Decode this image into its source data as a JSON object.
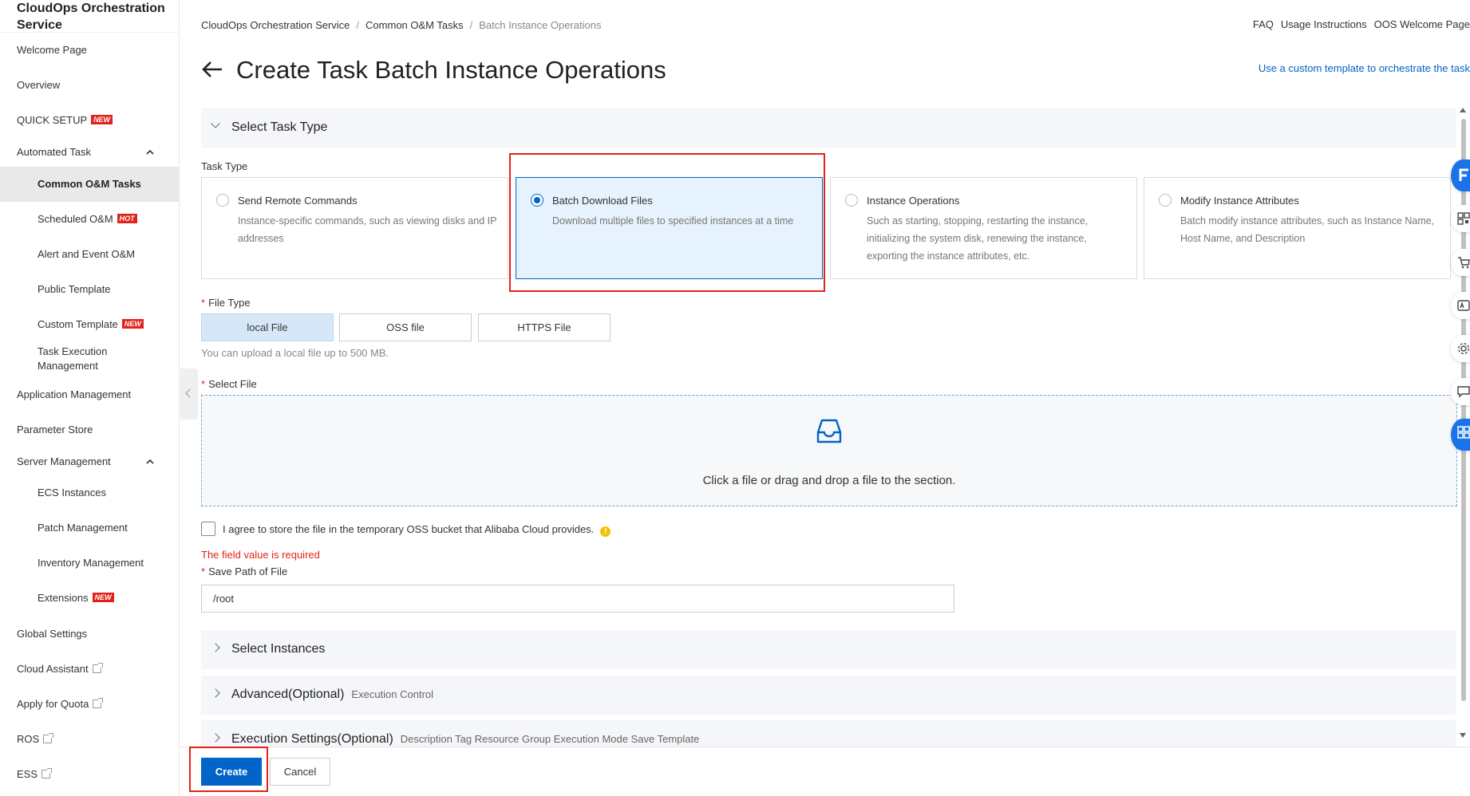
{
  "sidebar": {
    "title": "CloudOps Orchestration Service",
    "items": [
      {
        "label": "Welcome Page"
      },
      {
        "label": "Overview"
      },
      {
        "label": "QUICK SETUP",
        "badge": "NEW"
      },
      {
        "label": "Automated Task"
      },
      {
        "label": "Common O&M Tasks"
      },
      {
        "label": "Scheduled O&M",
        "badge": "HOT"
      },
      {
        "label": "Alert and Event O&M"
      },
      {
        "label": "Public Template"
      },
      {
        "label": "Custom Template",
        "badge": "NEW"
      },
      {
        "label": "Task Execution Management"
      },
      {
        "label": "Application Management"
      },
      {
        "label": "Parameter Store"
      },
      {
        "label": "Server Management"
      },
      {
        "label": "ECS Instances"
      },
      {
        "label": "Patch Management"
      },
      {
        "label": "Inventory Management"
      },
      {
        "label": "Extensions",
        "badge": "NEW"
      },
      {
        "label": "Global Settings"
      },
      {
        "label": "Cloud Assistant"
      },
      {
        "label": "Apply for Quota"
      },
      {
        "label": "ROS"
      },
      {
        "label": "ESS"
      }
    ]
  },
  "header": {
    "breadcrumb": [
      "CloudOps Orchestration Service",
      "Common O&M Tasks",
      "Batch Instance Operations"
    ],
    "breadcrumb_sep": "/",
    "links": [
      "FAQ",
      "Usage Instructions",
      "OOS Welcome Page"
    ],
    "title": "Create Task Batch Instance Operations",
    "custom_link": "Use a custom template to orchestrate the task"
  },
  "sections": {
    "task_type": "Select Task Type",
    "instances": "Select Instances",
    "advanced": "Advanced(Optional)",
    "advanced_hint": "Execution Control",
    "execution": "Execution Settings(Optional)",
    "execution_hint": "Description   Tag   Resource Group   Execution Mode   Save Template"
  },
  "form": {
    "task_type_label": "Task Type",
    "cards": [
      {
        "title": "Send Remote Commands",
        "desc": "Instance-specific commands, such as viewing disks and IP addresses",
        "selected": false
      },
      {
        "title": "Batch Download Files",
        "desc": "Download multiple files to specified instances at a time",
        "selected": true
      },
      {
        "title": "Instance Operations",
        "desc": "Such as starting, stopping, restarting the instance, initializing the system disk, renewing the instance, exporting the instance attributes, etc.",
        "selected": false
      },
      {
        "title": "Modify Instance Attributes",
        "desc": "Batch modify instance attributes, such as Instance Name, Host Name, and Description",
        "selected": false
      }
    ],
    "required_mark": "*",
    "file_type_label": "File Type",
    "file_types": [
      "local File",
      "OSS file",
      "HTTPS File"
    ],
    "file_type_selected": "local File",
    "file_type_hint": "You can upload a local file up to 500 MB.",
    "select_file_label": "Select File",
    "dropzone_text": "Click a file or drag and drop a file to the section.",
    "agree_label": "I agree to store the file in the temporary OSS bucket that Alibaba Cloud provides.",
    "agree_checked": false,
    "info_glyph": "!",
    "error": "The field value is required",
    "save_path_label": "Save Path of File",
    "save_path_value": "/root"
  },
  "footer": {
    "create": "Create",
    "cancel": "Cancel"
  },
  "colors": {
    "primary": "#0064c8",
    "error": "#e2231a",
    "highlight": "#e2231a"
  },
  "icons": [
    "back-arrow-icon",
    "chevron-up-icon",
    "external-link-icon",
    "inbox-icon",
    "info-icon",
    "qr-code-icon",
    "cart-icon",
    "settings-icon",
    "chat-icon",
    "apps-icon"
  ]
}
